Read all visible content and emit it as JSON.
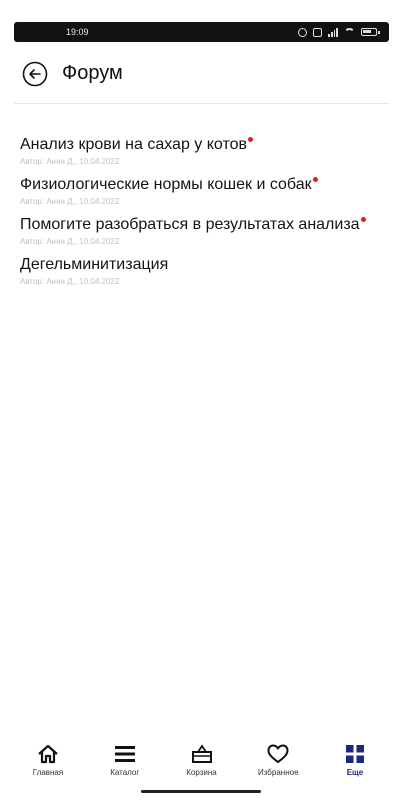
{
  "status_bar": {
    "time": "19:09"
  },
  "header": {
    "title": "Форум"
  },
  "topics": [
    {
      "title": "Анализ крови на сахар у котов",
      "meta": "Автор: Анна Д., 10.04.2022",
      "unread": true
    },
    {
      "title": "Физиологические нормы кошек и собак",
      "meta": "Автор: Анна Д., 10.04.2022",
      "unread": true
    },
    {
      "title": "Помогите разобраться в результатах анализа",
      "meta": "Автор: Анна Д., 10.04.2022",
      "unread": true
    },
    {
      "title": "Дегельминитизация",
      "meta": "Автор: Анна Д., 10.04.2022",
      "unread": false
    }
  ],
  "bottom_nav": {
    "items": [
      {
        "label": "Главная",
        "icon": "home-icon"
      },
      {
        "label": "Каталог",
        "icon": "menu-icon"
      },
      {
        "label": "Корзина",
        "icon": "basket-icon"
      },
      {
        "label": "Избранное",
        "icon": "heart-icon"
      },
      {
        "label": "Еще",
        "icon": "grid-icon",
        "active": true
      }
    ]
  },
  "colors": {
    "unread_dot": "#e21a2c",
    "active_nav": "#1a2a7a",
    "meta_text": "#c2c2c2"
  }
}
